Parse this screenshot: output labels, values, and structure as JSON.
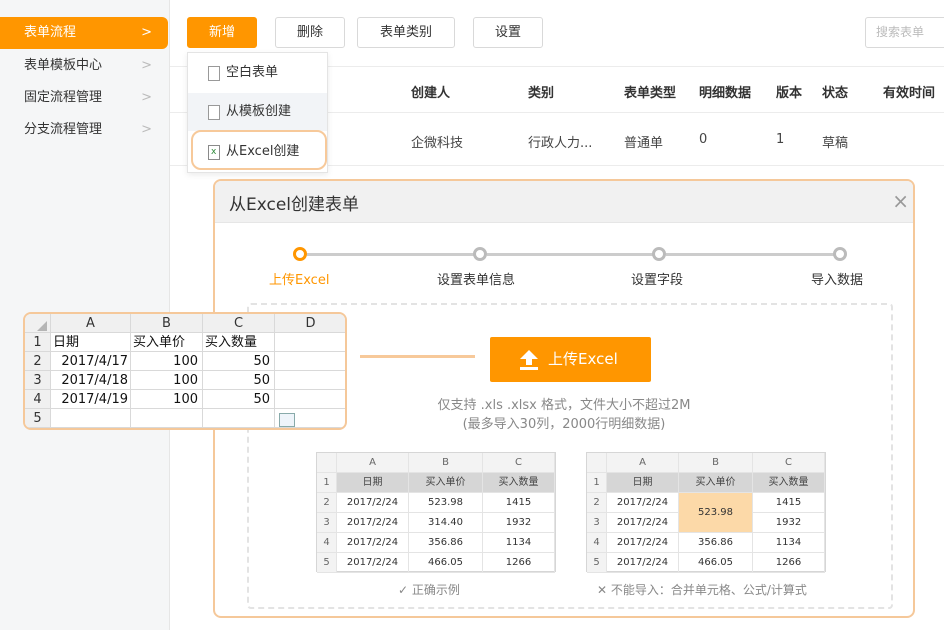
{
  "sidebar": {
    "items": [
      {
        "label": "表单流程",
        "active": true
      },
      {
        "label": "表单模板中心",
        "active": false
      },
      {
        "label": "固定流程管理",
        "active": false
      },
      {
        "label": "分支流程管理",
        "active": false
      }
    ],
    "chevron": ">"
  },
  "toolbar": {
    "add_label": "新增",
    "delete_label": "删除",
    "category_label": "表单类别",
    "settings_label": "设置",
    "search_placeholder": "搜索表单"
  },
  "dropdown": {
    "items": [
      "空白表单",
      "从模板创建",
      "从Excel创建"
    ]
  },
  "table": {
    "headers": [
      "创建人",
      "类别",
      "表单类型",
      "明细数据",
      "版本",
      "状态",
      "有效时间"
    ],
    "row": [
      "企微科技",
      "行政人力...",
      "普通单",
      "0",
      "1",
      "草稿",
      ""
    ]
  },
  "modal": {
    "title": "从Excel创建表单",
    "close": "×",
    "steps": [
      "上传Excel",
      "设置表单信息",
      "设置字段",
      "导入数据"
    ],
    "upload_label": "上传Excel",
    "hint1": "仅支持 .xls .xlsx 格式，文件大小不超过2M",
    "hint2": "(最多导入30列，2000行明细数据)",
    "correct_caption": "✓ 正确示例",
    "wrong_caption": "✕ 不能导入：合并单元格、公式/计算式"
  },
  "sample_correct": {
    "cols": [
      "A",
      "B",
      "C"
    ],
    "headers": [
      "日期",
      "买入单价",
      "买入数量"
    ],
    "rows": [
      [
        "2017/2/24",
        "523.98",
        "1415"
      ],
      [
        "2017/2/24",
        "314.40",
        "1932"
      ],
      [
        "2017/2/24",
        "356.86",
        "1134"
      ],
      [
        "2017/2/24",
        "466.05",
        "1266"
      ]
    ],
    "row_numbers": [
      "1",
      "2",
      "3",
      "4",
      "5"
    ]
  },
  "sample_wrong": {
    "cols": [
      "A",
      "B",
      "C"
    ],
    "headers": [
      "日期",
      "买入单价",
      "买入数量"
    ],
    "dates": [
      "2017/2/24",
      "2017/2/24",
      "2017/2/24",
      "2017/2/24"
    ],
    "merged_value": "523.98",
    "prices_rest": [
      "356.86",
      "466.05"
    ],
    "qty": [
      "1415",
      "1932",
      "1134",
      "1266"
    ],
    "row_numbers": [
      "1",
      "2",
      "3",
      "4",
      "5"
    ]
  },
  "excel_popout": {
    "cols": [
      "A",
      "B",
      "C",
      "D"
    ],
    "row_numbers": [
      "1",
      "2",
      "3",
      "4",
      "5"
    ],
    "headers": [
      "日期",
      "买入单价",
      "买入数量",
      ""
    ],
    "rows": [
      [
        "2017/4/17",
        "100",
        "50",
        ""
      ],
      [
        "2017/4/18",
        "100",
        "50",
        ""
      ],
      [
        "2017/4/19",
        "100",
        "50",
        ""
      ],
      [
        "",
        "",
        "",
        ""
      ]
    ]
  },
  "colors": {
    "accent": "#ff9600",
    "highlight": "#fcd9a8",
    "ring": "#f5c89a"
  }
}
